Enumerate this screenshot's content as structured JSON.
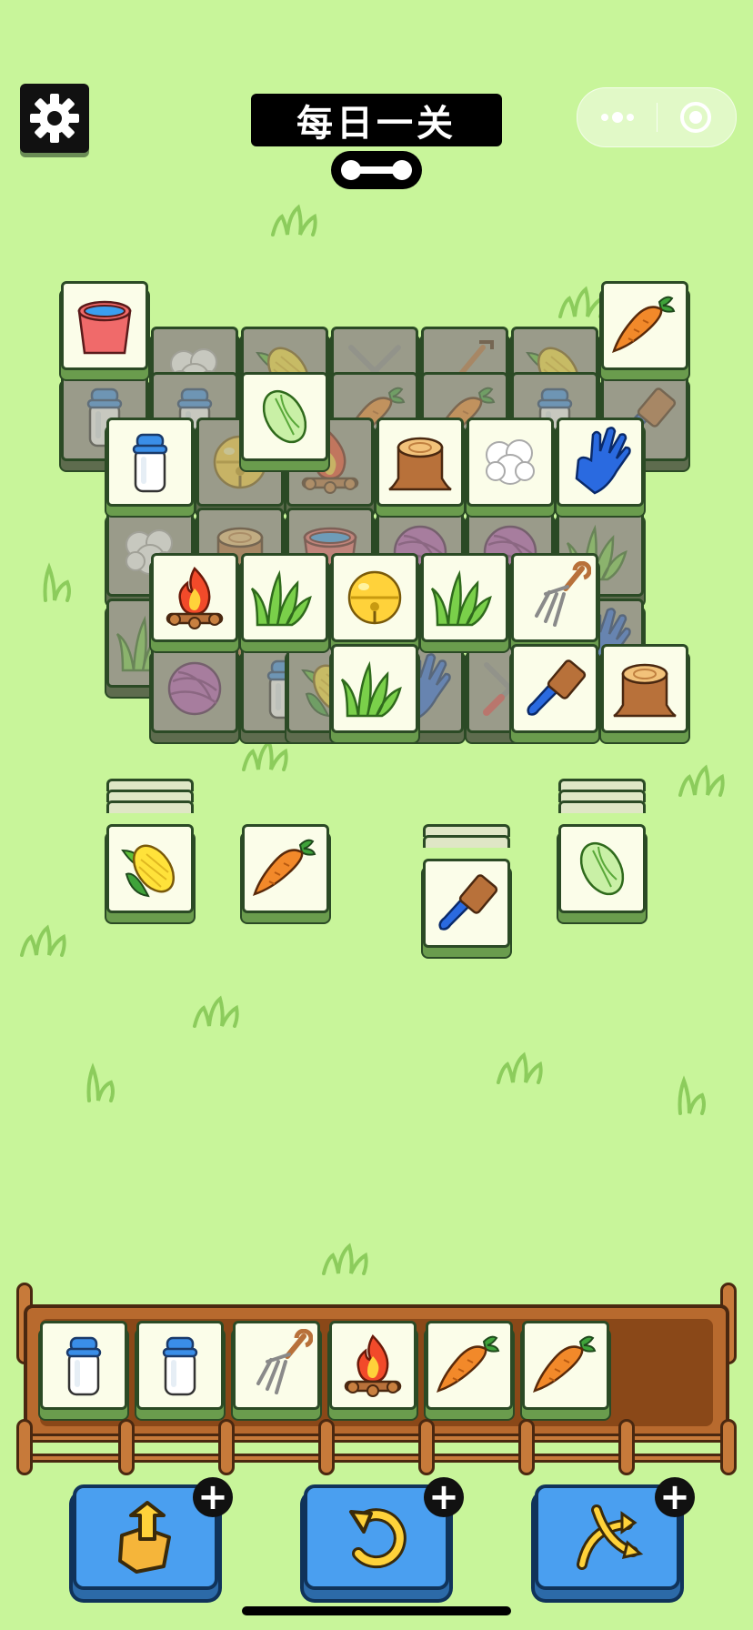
{
  "header": {
    "title": "每日一关",
    "settings_icon": "gear-icon",
    "menu_icon": "more-dots-icon",
    "close_icon": "target-circle-icon"
  },
  "board": {
    "covered_tiles": [
      "wool",
      "corn",
      "shears",
      "shovel",
      "corn",
      "milk-jar",
      "milk-jar",
      "carrot",
      "carrot",
      "milk-jar",
      "glove",
      "bell",
      "campfire",
      "wood-stump",
      "bucket",
      "yarn",
      "yarn",
      "grass",
      "wool",
      "wood-stump",
      "grass",
      "glove",
      "carrot",
      "yarn",
      "milk-jar",
      "corn",
      "glove",
      "shears"
    ],
    "open_tiles": [
      "bucket",
      "carrot",
      "cabbage",
      "milk-jar",
      "wood-stump",
      "wool",
      "glove",
      "campfire",
      "grass",
      "bell",
      "grass",
      "pitchfork",
      "grass",
      "brush",
      "wood-stump"
    ]
  },
  "stacks": [
    {
      "top": "corn",
      "depth": 4
    },
    {
      "top": "carrot",
      "depth": 1
    },
    {
      "top": "brush",
      "depth": 3
    },
    {
      "top": "cabbage",
      "depth": 4
    }
  ],
  "tray": {
    "capacity": 7,
    "slots": [
      "milk-jar",
      "milk-jar",
      "pitchfork",
      "campfire",
      "carrot",
      "carrot"
    ]
  },
  "tools": [
    {
      "name": "move-out",
      "icon": "box-arrow-up-icon",
      "badge": "+"
    },
    {
      "name": "undo",
      "icon": "undo-icon",
      "badge": "+"
    },
    {
      "name": "shuffle",
      "icon": "shuffle-icon",
      "badge": "+"
    }
  ],
  "colors": {
    "background": "#c8f59a",
    "tile_face": "#fbfde9",
    "tool_button": "#4a9ff0",
    "tray_wood": "#b86a2e"
  }
}
